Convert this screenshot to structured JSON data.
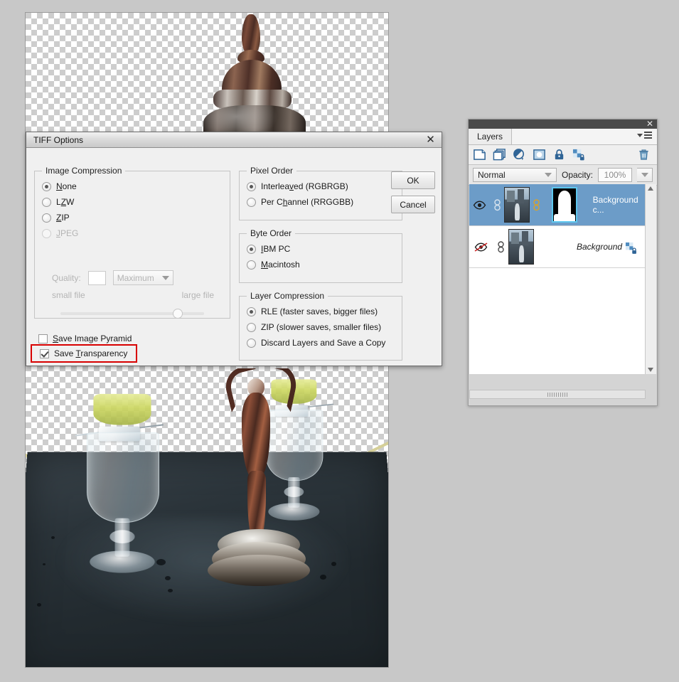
{
  "canvas": {
    "name": "document-canvas",
    "transparency_checker": true,
    "photo_description": "absinthe glasses and silver figurine on dark table, background removed"
  },
  "tiff_dialog": {
    "title": "TIFF Options",
    "close_icon": "close-icon",
    "buttons": {
      "ok": "OK",
      "cancel": "Cancel"
    },
    "image_compression": {
      "legend": "Image Compression",
      "options": [
        {
          "label": "None",
          "mnemonic": "N",
          "selected": true,
          "disabled": false
        },
        {
          "label": "LZW",
          "mnemonic": "Z",
          "selected": false,
          "disabled": false
        },
        {
          "label": "ZIP",
          "mnemonic": "Z",
          "selected": false,
          "disabled": false
        },
        {
          "label": "JPEG",
          "mnemonic": "J",
          "selected": false,
          "disabled": true
        }
      ],
      "quality_label": "Quality:",
      "quality_value": "",
      "quality_preset": "Maximum",
      "small_file_label": "small file",
      "large_file_label": "large file",
      "slider_position_percent": 78
    },
    "pixel_order": {
      "legend": "Pixel Order",
      "options": [
        {
          "label": "Interleaved (RGBRGB)",
          "selected": true
        },
        {
          "label": "Per Channel (RRGGBB)",
          "selected": false
        }
      ]
    },
    "byte_order": {
      "legend": "Byte Order",
      "options": [
        {
          "label": "IBM PC",
          "selected": true
        },
        {
          "label": "Macintosh",
          "selected": false
        }
      ]
    },
    "layer_compression": {
      "legend": "Layer Compression",
      "options": [
        {
          "label": "RLE (faster saves, bigger files)",
          "selected": true
        },
        {
          "label": "ZIP (slower saves, smaller files)",
          "selected": false
        },
        {
          "label": "Discard Layers and Save a Copy",
          "selected": false
        }
      ]
    },
    "checkboxes": [
      {
        "label": "Save Image Pyramid",
        "checked": false,
        "highlighted": false
      },
      {
        "label": "Save Transparency",
        "checked": true,
        "highlighted": true
      }
    ],
    "highlight_color": "#d80000"
  },
  "layers_panel": {
    "panel_close_icon": "close-icon",
    "tab_label": "Layers",
    "menu_icon": "panel-menu-icon",
    "icons": [
      "new-layer-icon",
      "duplicate-layer-icon",
      "adjustment-layer-icon",
      "layer-mask-icon",
      "lock-layer-icon",
      "lock-transparency-icon",
      "delete-layer-icon"
    ],
    "blend_mode": "Normal",
    "opacity_label": "Opacity:",
    "opacity_value": "100%",
    "layers": [
      {
        "name": "Background c...",
        "visible": true,
        "selected": true,
        "linked": true,
        "has_mask": true,
        "mask_selected": true,
        "locked": false,
        "italic": false
      },
      {
        "name": "Background",
        "visible": false,
        "selected": false,
        "linked": true,
        "has_mask": false,
        "mask_selected": false,
        "locked": true,
        "italic": true
      }
    ],
    "selection_color": "#6c9cc8"
  }
}
